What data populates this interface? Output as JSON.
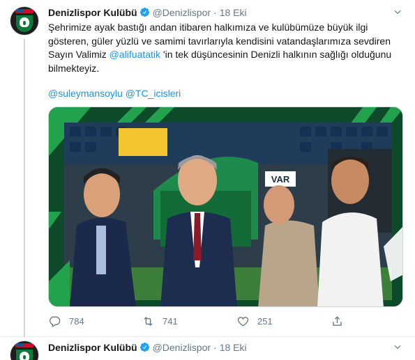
{
  "tweets": [
    {
      "author_name": "Denizlispor Kulübü",
      "author_handle": "@Denizlispor",
      "separator": "·",
      "time": "18 Eki",
      "text_part1": "Şehrimize ayak bastığı andan itibaren halkımıza ve kulübümüze büyük ilgi gösteren, güler yüzlü ve samimi tavırlarıyla kendisini vatandaşlarımıza sevdiren Sayın Valimiz ",
      "text_mention": "@alifuatatik",
      "text_part2": " 'in tek düşüncesinin Denizli halkının sağlığı olduğunu bilmekteyiz.",
      "mention_1": "@suleymansoylu",
      "mention_2": "@TC_icisleri",
      "photo_alt": "Photo: officials walking in a stadium",
      "photo_sign": "VAR",
      "counts": {
        "replies": "784",
        "retweets": "741",
        "likes": "251"
      }
    },
    {
      "author_name": "Denizlispor Kulübü",
      "author_handle": "@Denizlispor",
      "separator": "·",
      "time": "18 Eki"
    }
  ],
  "avatar_badge_text": "DENIZLISPOR",
  "colors": {
    "link": "#1b95e0",
    "verified": "#1da1f2",
    "secondary_text": "#657786",
    "club_green": "#0b7a3b"
  },
  "icons": [
    "verified-badge-icon",
    "chevron-down-icon",
    "reply-icon",
    "retweet-icon",
    "like-icon",
    "share-icon"
  ]
}
